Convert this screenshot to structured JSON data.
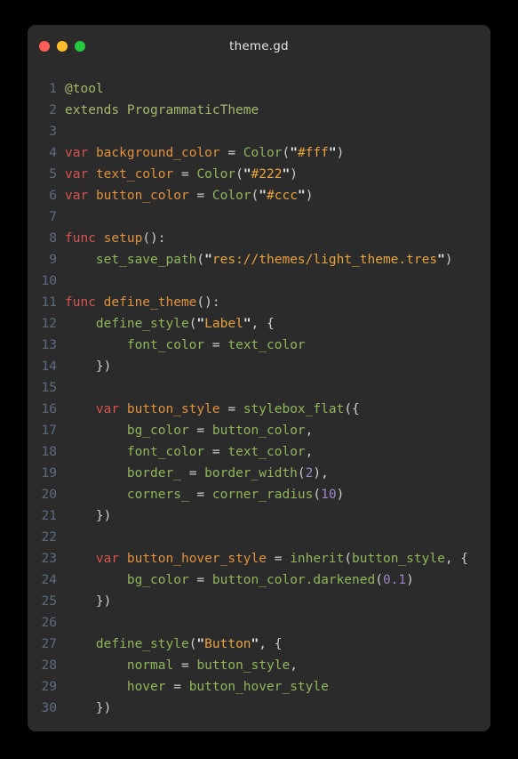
{
  "window": {
    "title": "theme.gd",
    "background_color": "#2b2b2b",
    "page_background": "#000000",
    "traffic_lights": [
      {
        "name": "close",
        "color": "#ff5f56"
      },
      {
        "name": "minimize",
        "color": "#ffbd2e"
      },
      {
        "name": "maximize",
        "color": "#27c93f"
      }
    ]
  },
  "editor": {
    "language": "gdscript",
    "line_number_color": "#5c6b7d",
    "lines": [
      {
        "n": "1",
        "tokens": [
          {
            "t": "@tool",
            "c": "t-ann"
          }
        ]
      },
      {
        "n": "2",
        "tokens": [
          {
            "t": "extends",
            "c": "t-ann"
          },
          {
            "t": " ",
            "c": "t-plain"
          },
          {
            "t": "ProgrammaticTheme",
            "c": "t-type"
          }
        ]
      },
      {
        "n": "3",
        "tokens": []
      },
      {
        "n": "4",
        "tokens": [
          {
            "t": "var",
            "c": "t-kw"
          },
          {
            "t": " ",
            "c": "t-plain"
          },
          {
            "t": "background_color",
            "c": "t-ident"
          },
          {
            "t": " ",
            "c": "t-plain"
          },
          {
            "t": "=",
            "c": "t-op"
          },
          {
            "t": " ",
            "c": "t-plain"
          },
          {
            "t": "Color",
            "c": "t-fn"
          },
          {
            "t": "(",
            "c": "t-punc"
          },
          {
            "t": "\"",
            "c": "t-quote"
          },
          {
            "t": "#fff",
            "c": "t-str"
          },
          {
            "t": "\"",
            "c": "t-quote"
          },
          {
            "t": ")",
            "c": "t-punc"
          }
        ]
      },
      {
        "n": "5",
        "tokens": [
          {
            "t": "var",
            "c": "t-kw"
          },
          {
            "t": " ",
            "c": "t-plain"
          },
          {
            "t": "text_color",
            "c": "t-ident"
          },
          {
            "t": " ",
            "c": "t-plain"
          },
          {
            "t": "=",
            "c": "t-op"
          },
          {
            "t": " ",
            "c": "t-plain"
          },
          {
            "t": "Color",
            "c": "t-fn"
          },
          {
            "t": "(",
            "c": "t-punc"
          },
          {
            "t": "\"",
            "c": "t-quote"
          },
          {
            "t": "#222",
            "c": "t-str"
          },
          {
            "t": "\"",
            "c": "t-quote"
          },
          {
            "t": ")",
            "c": "t-punc"
          }
        ]
      },
      {
        "n": "6",
        "tokens": [
          {
            "t": "var",
            "c": "t-kw"
          },
          {
            "t": " ",
            "c": "t-plain"
          },
          {
            "t": "button_color",
            "c": "t-ident"
          },
          {
            "t": " ",
            "c": "t-plain"
          },
          {
            "t": "=",
            "c": "t-op"
          },
          {
            "t": " ",
            "c": "t-plain"
          },
          {
            "t": "Color",
            "c": "t-fn"
          },
          {
            "t": "(",
            "c": "t-punc"
          },
          {
            "t": "\"",
            "c": "t-quote"
          },
          {
            "t": "#ccc",
            "c": "t-str"
          },
          {
            "t": "\"",
            "c": "t-quote"
          },
          {
            "t": ")",
            "c": "t-punc"
          }
        ]
      },
      {
        "n": "7",
        "tokens": []
      },
      {
        "n": "8",
        "tokens": [
          {
            "t": "func",
            "c": "t-kw"
          },
          {
            "t": " ",
            "c": "t-plain"
          },
          {
            "t": "setup",
            "c": "t-ident"
          },
          {
            "t": "():",
            "c": "t-punc"
          }
        ]
      },
      {
        "n": "9",
        "tokens": [
          {
            "t": "    ",
            "c": "t-plain"
          },
          {
            "t": "set_save_path",
            "c": "t-fn"
          },
          {
            "t": "(",
            "c": "t-punc"
          },
          {
            "t": "\"",
            "c": "t-quote"
          },
          {
            "t": "res://themes/light_theme.tres",
            "c": "t-str"
          },
          {
            "t": "\"",
            "c": "t-quote"
          },
          {
            "t": ")",
            "c": "t-punc"
          }
        ]
      },
      {
        "n": "10",
        "tokens": []
      },
      {
        "n": "11",
        "tokens": [
          {
            "t": "func",
            "c": "t-kw"
          },
          {
            "t": " ",
            "c": "t-plain"
          },
          {
            "t": "define_theme",
            "c": "t-ident"
          },
          {
            "t": "():",
            "c": "t-punc"
          }
        ]
      },
      {
        "n": "12",
        "tokens": [
          {
            "t": "    ",
            "c": "t-plain"
          },
          {
            "t": "define_style",
            "c": "t-fn"
          },
          {
            "t": "(",
            "c": "t-punc"
          },
          {
            "t": "\"",
            "c": "t-quote"
          },
          {
            "t": "Label",
            "c": "t-str"
          },
          {
            "t": "\"",
            "c": "t-quote"
          },
          {
            "t": ", {",
            "c": "t-punc"
          }
        ]
      },
      {
        "n": "13",
        "tokens": [
          {
            "t": "        ",
            "c": "t-plain"
          },
          {
            "t": "font_color",
            "c": "t-prop"
          },
          {
            "t": " ",
            "c": "t-plain"
          },
          {
            "t": "=",
            "c": "t-op"
          },
          {
            "t": " ",
            "c": "t-plain"
          },
          {
            "t": "text_color",
            "c": "t-prop"
          }
        ]
      },
      {
        "n": "14",
        "tokens": [
          {
            "t": "    ",
            "c": "t-plain"
          },
          {
            "t": "})",
            "c": "t-punc"
          }
        ]
      },
      {
        "n": "15",
        "tokens": []
      },
      {
        "n": "16",
        "tokens": [
          {
            "t": "    ",
            "c": "t-plain"
          },
          {
            "t": "var",
            "c": "t-kw"
          },
          {
            "t": " ",
            "c": "t-plain"
          },
          {
            "t": "button_style",
            "c": "t-ident"
          },
          {
            "t": " ",
            "c": "t-plain"
          },
          {
            "t": "=",
            "c": "t-op"
          },
          {
            "t": " ",
            "c": "t-plain"
          },
          {
            "t": "stylebox_flat",
            "c": "t-fn"
          },
          {
            "t": "({",
            "c": "t-punc"
          }
        ]
      },
      {
        "n": "17",
        "tokens": [
          {
            "t": "        ",
            "c": "t-plain"
          },
          {
            "t": "bg_color",
            "c": "t-prop"
          },
          {
            "t": " ",
            "c": "t-plain"
          },
          {
            "t": "=",
            "c": "t-op"
          },
          {
            "t": " ",
            "c": "t-plain"
          },
          {
            "t": "button_color",
            "c": "t-prop"
          },
          {
            "t": ",",
            "c": "t-punc"
          }
        ]
      },
      {
        "n": "18",
        "tokens": [
          {
            "t": "        ",
            "c": "t-plain"
          },
          {
            "t": "font_color",
            "c": "t-prop"
          },
          {
            "t": " ",
            "c": "t-plain"
          },
          {
            "t": "=",
            "c": "t-op"
          },
          {
            "t": " ",
            "c": "t-plain"
          },
          {
            "t": "text_color",
            "c": "t-prop"
          },
          {
            "t": ",",
            "c": "t-punc"
          }
        ]
      },
      {
        "n": "19",
        "tokens": [
          {
            "t": "        ",
            "c": "t-plain"
          },
          {
            "t": "border_",
            "c": "t-prop"
          },
          {
            "t": " ",
            "c": "t-plain"
          },
          {
            "t": "=",
            "c": "t-op"
          },
          {
            "t": " ",
            "c": "t-plain"
          },
          {
            "t": "border_width",
            "c": "t-prop"
          },
          {
            "t": "(",
            "c": "t-punc"
          },
          {
            "t": "2",
            "c": "t-num"
          },
          {
            "t": "),",
            "c": "t-punc"
          }
        ]
      },
      {
        "n": "20",
        "tokens": [
          {
            "t": "        ",
            "c": "t-plain"
          },
          {
            "t": "corners_",
            "c": "t-prop"
          },
          {
            "t": " ",
            "c": "t-plain"
          },
          {
            "t": "=",
            "c": "t-op"
          },
          {
            "t": " ",
            "c": "t-plain"
          },
          {
            "t": "corner_radius",
            "c": "t-prop"
          },
          {
            "t": "(",
            "c": "t-punc"
          },
          {
            "t": "10",
            "c": "t-num"
          },
          {
            "t": ")",
            "c": "t-punc"
          }
        ]
      },
      {
        "n": "21",
        "tokens": [
          {
            "t": "    ",
            "c": "t-plain"
          },
          {
            "t": "})",
            "c": "t-punc"
          }
        ]
      },
      {
        "n": "22",
        "tokens": []
      },
      {
        "n": "23",
        "tokens": [
          {
            "t": "    ",
            "c": "t-plain"
          },
          {
            "t": "var",
            "c": "t-kw"
          },
          {
            "t": " ",
            "c": "t-plain"
          },
          {
            "t": "button_hover_style",
            "c": "t-ident"
          },
          {
            "t": " ",
            "c": "t-plain"
          },
          {
            "t": "=",
            "c": "t-op"
          },
          {
            "t": " ",
            "c": "t-plain"
          },
          {
            "t": "inherit",
            "c": "t-fn"
          },
          {
            "t": "(",
            "c": "t-punc"
          },
          {
            "t": "button_style",
            "c": "t-prop"
          },
          {
            "t": ", {",
            "c": "t-punc"
          }
        ]
      },
      {
        "n": "24",
        "tokens": [
          {
            "t": "        ",
            "c": "t-plain"
          },
          {
            "t": "bg_color",
            "c": "t-prop"
          },
          {
            "t": " ",
            "c": "t-plain"
          },
          {
            "t": "=",
            "c": "t-op"
          },
          {
            "t": " ",
            "c": "t-plain"
          },
          {
            "t": "button_color.darkened",
            "c": "t-prop"
          },
          {
            "t": "(",
            "c": "t-punc"
          },
          {
            "t": "0.1",
            "c": "t-num"
          },
          {
            "t": ")",
            "c": "t-punc"
          }
        ]
      },
      {
        "n": "25",
        "tokens": [
          {
            "t": "    ",
            "c": "t-plain"
          },
          {
            "t": "})",
            "c": "t-punc"
          }
        ]
      },
      {
        "n": "26",
        "tokens": []
      },
      {
        "n": "27",
        "tokens": [
          {
            "t": "    ",
            "c": "t-plain"
          },
          {
            "t": "define_style",
            "c": "t-fn"
          },
          {
            "t": "(",
            "c": "t-punc"
          },
          {
            "t": "\"",
            "c": "t-quote"
          },
          {
            "t": "Button",
            "c": "t-str"
          },
          {
            "t": "\"",
            "c": "t-quote"
          },
          {
            "t": ", {",
            "c": "t-punc"
          }
        ]
      },
      {
        "n": "28",
        "tokens": [
          {
            "t": "        ",
            "c": "t-plain"
          },
          {
            "t": "normal",
            "c": "t-prop"
          },
          {
            "t": " ",
            "c": "t-plain"
          },
          {
            "t": "=",
            "c": "t-op"
          },
          {
            "t": " ",
            "c": "t-plain"
          },
          {
            "t": "button_style",
            "c": "t-prop"
          },
          {
            "t": ",",
            "c": "t-punc"
          }
        ]
      },
      {
        "n": "29",
        "tokens": [
          {
            "t": "        ",
            "c": "t-plain"
          },
          {
            "t": "hover",
            "c": "t-prop"
          },
          {
            "t": " ",
            "c": "t-plain"
          },
          {
            "t": "=",
            "c": "t-op"
          },
          {
            "t": " ",
            "c": "t-plain"
          },
          {
            "t": "button_hover_style",
            "c": "t-prop"
          }
        ]
      },
      {
        "n": "30",
        "tokens": [
          {
            "t": "    ",
            "c": "t-plain"
          },
          {
            "t": "})",
            "c": "t-punc"
          }
        ]
      }
    ]
  }
}
